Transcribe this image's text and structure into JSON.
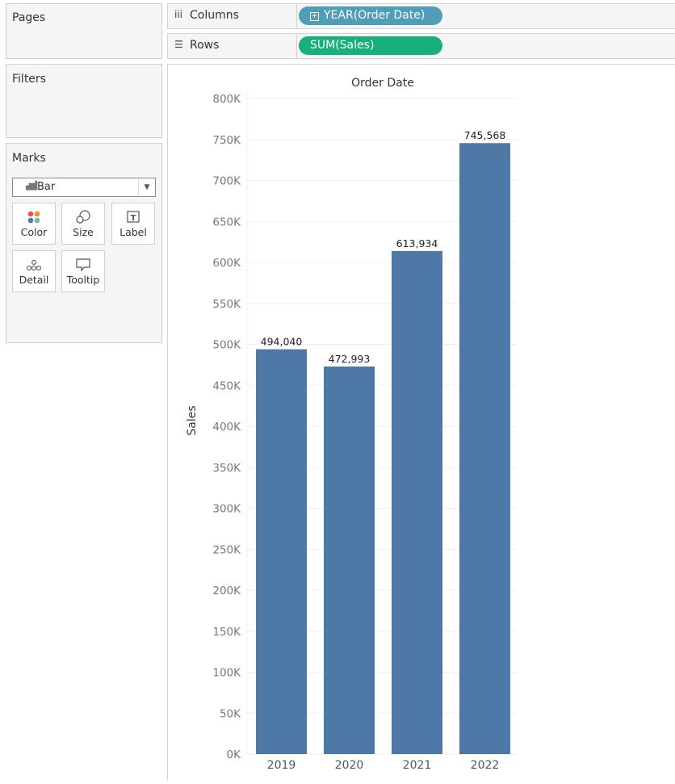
{
  "left_panel": {
    "pages_title": "Pages",
    "filters_title": "Filters",
    "marks_title": "Marks",
    "mark_type": "Bar",
    "mark_buttons": [
      "Color",
      "Size",
      "Label",
      "Detail",
      "Tooltip"
    ]
  },
  "shelves": {
    "columns_label": "Columns",
    "columns_pill": "YEAR(Order Date)",
    "rows_label": "Rows",
    "rows_pill": "SUM(Sales)"
  },
  "colors": {
    "bar": "#4e79a7",
    "columns_pill": "#4f9db6",
    "rows_pill": "#17b07c"
  },
  "chart_data": {
    "type": "bar",
    "title": "Order Date",
    "xlabel": "",
    "ylabel": "Sales",
    "categories": [
      "2019",
      "2020",
      "2021",
      "2022"
    ],
    "values": [
      494040,
      472993,
      613934,
      745568
    ],
    "data_labels": [
      "494,040",
      "472,993",
      "613,934",
      "745,568"
    ],
    "ylim": [
      0,
      800000
    ],
    "yticks": [
      0,
      50000,
      100000,
      150000,
      200000,
      250000,
      300000,
      350000,
      400000,
      450000,
      500000,
      550000,
      600000,
      650000,
      700000,
      750000,
      800000
    ],
    "ytick_labels": [
      "0K",
      "50K",
      "100K",
      "150K",
      "200K",
      "250K",
      "300K",
      "350K",
      "400K",
      "450K",
      "500K",
      "550K",
      "600K",
      "650K",
      "700K",
      "750K",
      "800K"
    ],
    "grid": true
  }
}
